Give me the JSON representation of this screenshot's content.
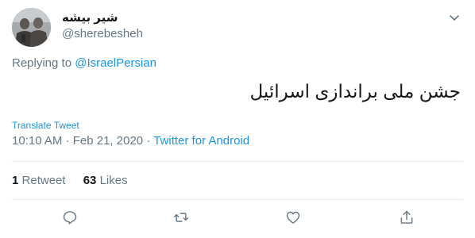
{
  "author": {
    "display_name": "شیر بیشه",
    "handle": "@sherebesheh"
  },
  "reply": {
    "prefix": "Replying to",
    "mention": "@IsraelPersian"
  },
  "tweet": {
    "text": "جشن ملی براندازی اسرائیل",
    "translate_label": "Translate Tweet",
    "time": "10:10 AM",
    "date": "Feb 21, 2020",
    "separator": "·",
    "source": "Twitter for Android"
  },
  "stats": {
    "retweets_count": "1",
    "retweets_label": "Retweet",
    "likes_count": "63",
    "likes_label": "Likes"
  },
  "icons": {
    "reply": "reply-icon",
    "retweet": "retweet-icon",
    "like": "heart-icon",
    "share": "share-icon",
    "menu": "chevron-down-icon"
  },
  "colors": {
    "link": "#1b95e0",
    "secondary_text": "#657786",
    "primary_text": "#14171a",
    "divider": "#e6ecf0"
  }
}
